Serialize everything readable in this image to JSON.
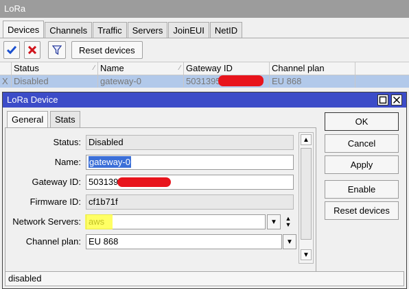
{
  "window": {
    "title": "LoRa"
  },
  "tabs": [
    "Devices",
    "Channels",
    "Traffic",
    "Servers",
    "JoinEUI",
    "NetID"
  ],
  "toolbar": {
    "enable_icon": "checkmark-icon",
    "disable_icon": "x-icon",
    "filter_icon": "filter-icon",
    "reset_label": "Reset devices"
  },
  "table": {
    "columns": [
      "",
      "Status",
      "Name",
      "Gateway ID",
      "Channel plan"
    ],
    "rows": [
      {
        "flag": "X",
        "status": "Disabled",
        "name": "gateway-0",
        "gateway_id": "5031395",
        "channel_plan": "EU 868"
      }
    ]
  },
  "dialog": {
    "title": "LoRa Device",
    "tabs": [
      "General",
      "Stats"
    ],
    "fields": {
      "status": {
        "label": "Status:",
        "value": "Disabled"
      },
      "name": {
        "label": "Name:",
        "value": "gateway-0"
      },
      "gateway_id": {
        "label": "Gateway ID:",
        "value": "503139"
      },
      "firmware_id": {
        "label": "Firmware ID:",
        "value": "cf1b71f"
      },
      "network_servers": {
        "label": "Network Servers:",
        "value": "aws"
      },
      "channel_plan": {
        "label": "Channel plan:",
        "value": "EU 868"
      }
    },
    "buttons": {
      "ok": "OK",
      "cancel": "Cancel",
      "apply": "Apply",
      "enable": "Enable",
      "reset": "Reset devices"
    },
    "status_text": "disabled"
  },
  "colors": {
    "dialog_title": "#3c4cc8",
    "selection": "#b2c9ea",
    "redaction": "#e8141c",
    "highlight": "#ffff30"
  }
}
